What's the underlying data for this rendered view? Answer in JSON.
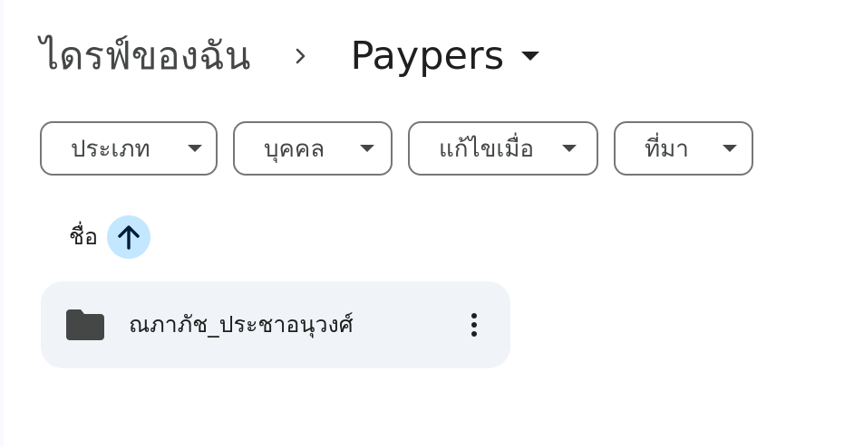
{
  "breadcrumb": {
    "root_label": "ไดรฟ์ของฉัน",
    "separator_icon": "chevron-right-icon",
    "current_label": "Paypers",
    "current_caret_icon": "caret-down-icon"
  },
  "filters": [
    {
      "label": "ประเภท",
      "icon": "caret-down-icon"
    },
    {
      "label": "บุคคล",
      "icon": "caret-down-icon"
    },
    {
      "label": "แก้ไขเมื่อ",
      "icon": "caret-down-icon"
    },
    {
      "label": "ที่มา",
      "icon": "caret-down-icon"
    }
  ],
  "sort": {
    "label": "ชื่อ",
    "direction": "ascending",
    "icon": "arrow-up-icon"
  },
  "items": [
    {
      "type": "folder",
      "icon": "folder-icon",
      "name": "ณภาภัช_ประชาอนุวงศ์",
      "menu_icon": "more-vert-icon"
    }
  ],
  "colors": {
    "chip_border": "#747775",
    "sort_badge": "#c2e7ff",
    "sort_arrow": "#001d35",
    "card_background": "#f0f4f9",
    "folder_icon": "#444746"
  }
}
